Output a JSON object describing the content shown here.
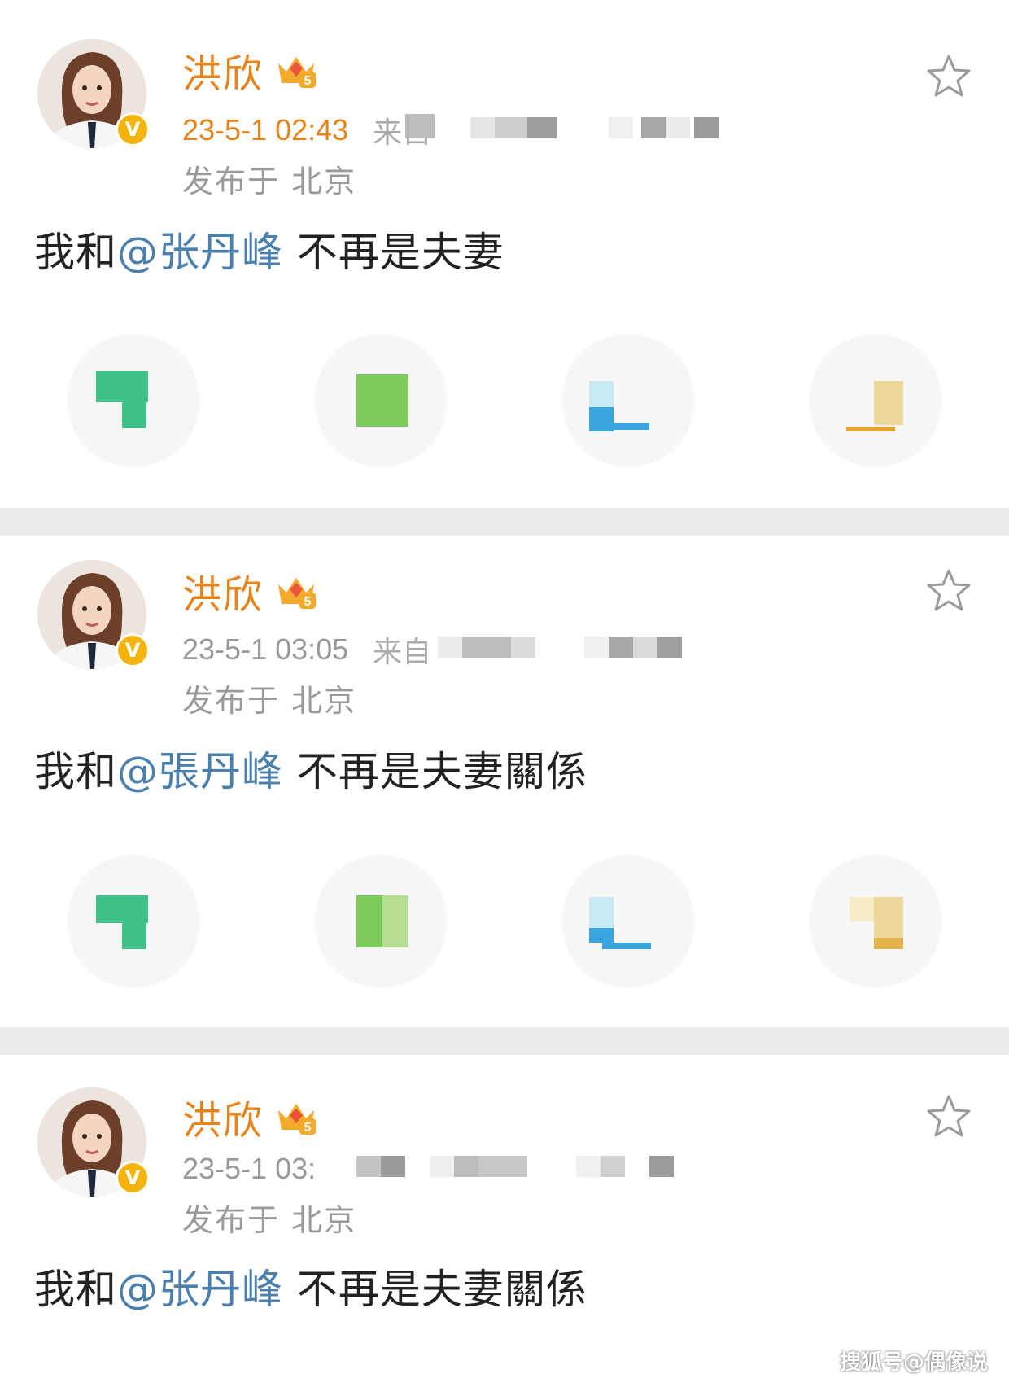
{
  "posts": [
    {
      "name": "洪欣",
      "time": "23-5-1 02:43",
      "time_color": "orange",
      "source": "来自",
      "location": "发布于 北京",
      "content_prefix": "我和",
      "mention": "@张丹峰",
      "content_suffix": " 不再是夫妻"
    },
    {
      "name": "洪欣",
      "time": "23-5-1 03:05",
      "time_color": "gray",
      "source": "来自",
      "location": "发布于 北京",
      "content_prefix": "我和",
      "mention": "@張丹峰",
      "content_suffix": " 不再是夫妻關係"
    },
    {
      "name": "洪欣",
      "time": "23-5-1 03:",
      "time_color": "gray",
      "source": "",
      "location": "发布于 北京",
      "content_prefix": "我和",
      "mention": "@张丹峰",
      "content_suffix": " 不再是夫妻關係"
    }
  ],
  "icons": {
    "verified": "verified-v-badge-icon",
    "vip": "vip-crown-level-5-icon",
    "favorite": "star-icon",
    "share_targets": [
      "wechat-icon",
      "moments-icon",
      "qq-icon",
      "qzone-icon"
    ]
  },
  "badge": {
    "verified_text": "V",
    "vip_level": "5"
  },
  "colors": {
    "name": "#e8831b",
    "mention": "#4a7fae",
    "separator": "#ededed",
    "share_green": "#3fc28a",
    "share_lightgreen": "#7ccb5c",
    "share_blue": "#3aa6e0",
    "share_yellow": "#f1c04d"
  },
  "watermark": "搜狐号@偶像说"
}
